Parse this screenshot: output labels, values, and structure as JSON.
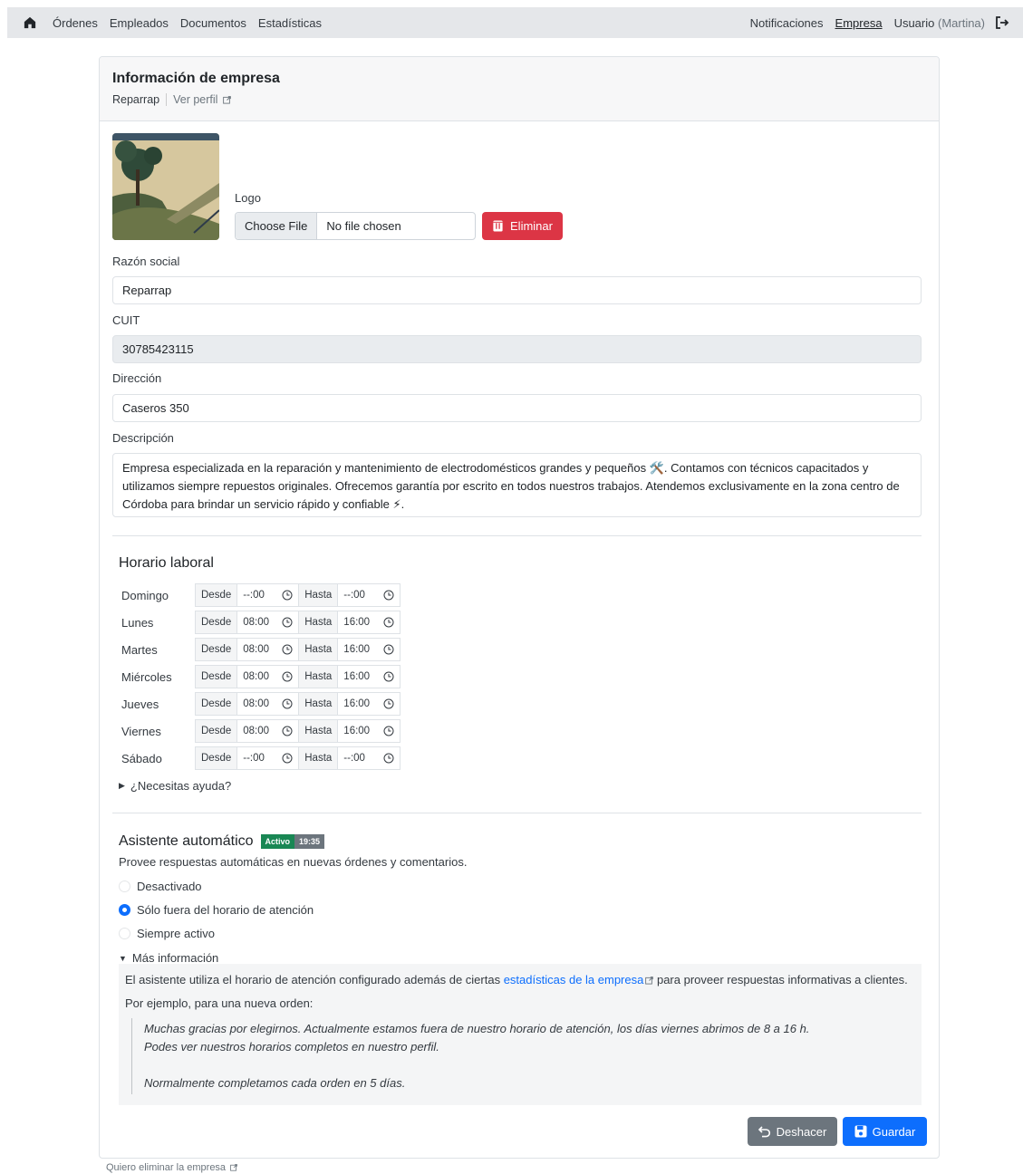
{
  "nav": {
    "left": [
      "Órdenes",
      "Empleados",
      "Documentos",
      "Estadísticas"
    ],
    "notifications": "Notificaciones",
    "company": "Empresa",
    "user": "Usuario",
    "user_name": "(Martina)"
  },
  "header": {
    "title": "Información de empresa",
    "company": "Reparrap",
    "profile_link": "Ver perfil"
  },
  "logo": {
    "label": "Logo",
    "choose_file": "Choose File",
    "no_file": "No file chosen",
    "delete": "Eliminar"
  },
  "fields": {
    "razon_label": "Razón social",
    "razon_value": "Reparrap",
    "cuit_label": "CUIT",
    "cuit_value": "30785423115",
    "direccion_label": "Dirección",
    "direccion_value": "Caseros 350",
    "descripcion_label": "Descripción",
    "descripcion_value": "Empresa especializada en la reparación y mantenimiento de electrodomésticos grandes y pequeños 🛠️. Contamos con técnicos capacitados y utilizamos siempre repuestos originales. Ofrecemos garantía por escrito en todos nuestros trabajos. Atendemos exclusivamente en la zona centro de Córdoba para brindar un servicio rápido y confiable ⚡."
  },
  "schedule": {
    "title": "Horario laboral",
    "from_label": "Desde",
    "to_label": "Hasta",
    "days": [
      {
        "day": "Domingo",
        "from": "--:00",
        "to": "--:00"
      },
      {
        "day": "Lunes",
        "from": "08:00",
        "to": "16:00"
      },
      {
        "day": "Martes",
        "from": "08:00",
        "to": "16:00"
      },
      {
        "day": "Miércoles",
        "from": "08:00",
        "to": "16:00"
      },
      {
        "day": "Jueves",
        "from": "08:00",
        "to": "16:00"
      },
      {
        "day": "Viernes",
        "from": "08:00",
        "to": "16:00"
      },
      {
        "day": "Sábado",
        "from": "--:00",
        "to": "--:00"
      }
    ],
    "help": "¿Necesitas ayuda?"
  },
  "assistant": {
    "title": "Asistente automático",
    "badge_status": "Activo",
    "badge_time": "19:35",
    "description": "Provee respuestas automáticas en nuevas órdenes y comentarios.",
    "options": [
      "Desactivado",
      "Sólo fuera del horario de atención",
      "Siempre activo"
    ],
    "selected": 1,
    "more_info": "Más información",
    "info_pre": "El asistente utiliza el horario de atención configurado además de ciertas",
    "info_link": "estadísticas de la empresa",
    "info_post": "para proveer respuestas informativas a clientes.",
    "example_intro": "Por ejemplo, para una nueva orden:",
    "quote_1": "Muchas gracias por elegirnos. Actualmente estamos fuera de nuestro horario de atención, los días viernes abrimos de 8 a 16 h.",
    "quote_2": "Podes ver nuestros horarios completos en nuestro perfil.",
    "quote_3": "Normalmente completamos cada orden en 5 días."
  },
  "actions": {
    "undo": "Deshacer",
    "save": "Guardar"
  },
  "footer": {
    "delete_company": "Quiero eliminar la empresa"
  }
}
